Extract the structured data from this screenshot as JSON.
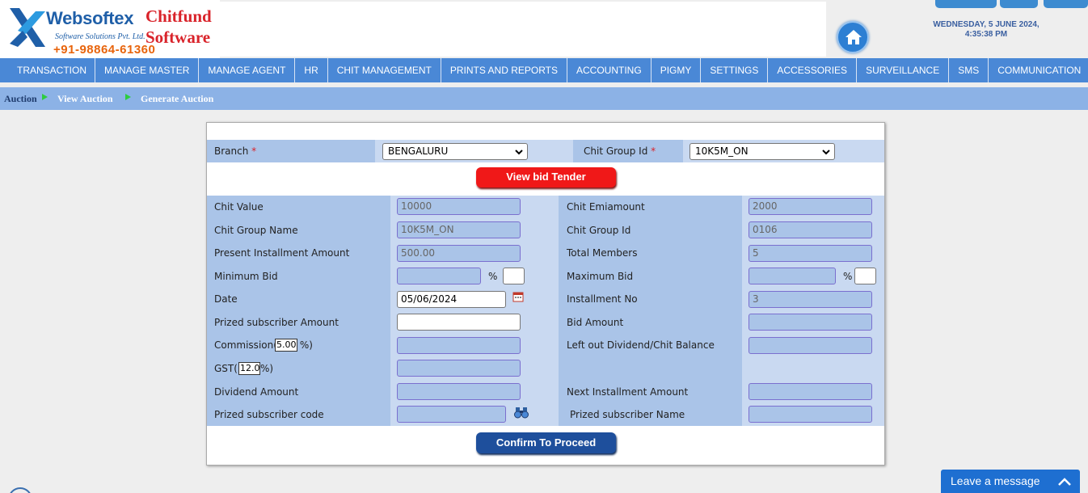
{
  "header": {
    "logo_name": "Websoftex",
    "logo_sub": "Software Solutions Pvt. Ltd.",
    "logo_phone": "+91-98864-61360",
    "brand_line1": "Chitfund",
    "brand_line2": "Software",
    "date": "WEDNESDAY, 5 JUNE 2024,",
    "time": "4:35:38 PM"
  },
  "nav": {
    "items": [
      "TRANSACTION",
      "MANAGE MASTER",
      "MANAGE AGENT",
      "HR",
      "CHIT MANAGEMENT",
      "PRINTS AND REPORTS",
      "ACCOUNTING",
      "PIGMY",
      "SETTINGS",
      "ACCESSORIES",
      "SURVEILLANCE",
      "SMS",
      "COMMUNICATION"
    ]
  },
  "breadcrumb": {
    "item1": "Auction",
    "item2": "View Auction",
    "item3": "Generate Auction"
  },
  "form": {
    "branch_label": "Branch",
    "branch_value": "BENGALURU",
    "chit_group_id_label": "Chit Group Id",
    "chit_group_id_value": "10K5M_ON",
    "required_mark": "*",
    "view_bid_button": "View bid Tender",
    "confirm_button": "Confirm To Proceed",
    "percent": "%",
    "fields": {
      "chit_value": {
        "label": "Chit Value",
        "value": "10000"
      },
      "chit_emiamount": {
        "label": "Chit Emiamount",
        "value": "2000"
      },
      "chit_group_name": {
        "label": "Chit Group Name",
        "value": "10K5M_ON"
      },
      "chit_group_id": {
        "label": "Chit Group Id",
        "value": "0106"
      },
      "present_installment": {
        "label": "Present Installment Amount",
        "value": "500.00"
      },
      "total_members": {
        "label": "Total Members",
        "value": "5"
      },
      "minimum_bid": {
        "label": "Minimum Bid",
        "value": ""
      },
      "maximum_bid": {
        "label": "Maximum Bid",
        "value": ""
      },
      "date": {
        "label": "Date",
        "value": "05/06/2024"
      },
      "installment_no": {
        "label": "Installment No",
        "value": "3"
      },
      "prized_subscriber_amount": {
        "label": "Prized subscriber Amount",
        "value": ""
      },
      "bid_amount": {
        "label": "Bid Amount",
        "value": ""
      },
      "commission": {
        "label_pre": "Commission(",
        "label_post": "%)",
        "rate": "5.00",
        "value": ""
      },
      "left_out_dividend": {
        "label": "Left out Dividend/Chit Balance",
        "value": ""
      },
      "gst": {
        "label_pre": "GST(",
        "label_post": "%)",
        "rate": "12.0",
        "value": ""
      },
      "dividend_amount": {
        "label": "Dividend Amount",
        "value": ""
      },
      "next_installment": {
        "label": "Next Installment Amount",
        "value": ""
      },
      "prized_subscriber_code": {
        "label": "Prized subscriber code",
        "value": ""
      },
      "prized_subscriber_name": {
        "label": "Prized subscriber Name",
        "value": ""
      }
    }
  },
  "chat": {
    "label": "Leave a message"
  },
  "colors": {
    "nav": "#4a88d6",
    "band": "#aac4e8",
    "red_button": "#f01818",
    "blue_button": "#1e4f9c"
  }
}
